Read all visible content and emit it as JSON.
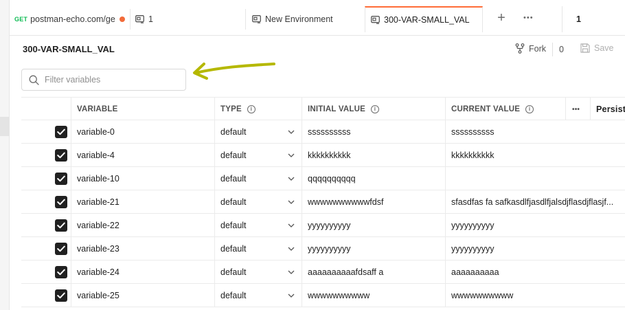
{
  "tabs": [
    {
      "method": "GET",
      "label": "postman-echo.com/ge",
      "unsaved": true
    },
    {
      "label": "1"
    },
    {
      "label": "New Environment"
    },
    {
      "label": "300-VAR-SMALL_VAL",
      "active": true
    }
  ],
  "tabbar": {
    "new_tab": "+",
    "more": "•••",
    "environment_selector": "1"
  },
  "header": {
    "title": "300-VAR-SMALL_VAL",
    "fork_label": "Fork",
    "fork_count": "0",
    "save_label": "Save"
  },
  "filter": {
    "placeholder": "Filter variables",
    "value": ""
  },
  "table": {
    "headers": {
      "variable": "VARIABLE",
      "type": "TYPE",
      "initial": "INITIAL VALUE",
      "current": "CURRENT VALUE",
      "more": "•••",
      "persist": "Persist"
    },
    "rows": [
      {
        "enabled": true,
        "variable": "variable-0",
        "type": "default",
        "initial": "ssssssssss",
        "current": "ssssssssss"
      },
      {
        "enabled": true,
        "variable": "variable-4",
        "type": "default",
        "initial": "kkkkkkkkkk",
        "current": "kkkkkkkkkk"
      },
      {
        "enabled": true,
        "variable": "variable-10",
        "type": "default",
        "initial": "qqqqqqqqqq",
        "current": ""
      },
      {
        "enabled": true,
        "variable": "variable-21",
        "type": "default",
        "initial": "wwwwwwwwwwfdsf",
        "current": "sfasdfas fa safkasdlfjasdlfjalsdjflasdjflasjf..."
      },
      {
        "enabled": true,
        "variable": "variable-22",
        "type": "default",
        "initial": "yyyyyyyyyy",
        "current": "yyyyyyyyyy"
      },
      {
        "enabled": true,
        "variable": "variable-23",
        "type": "default",
        "initial": "yyyyyyyyyy",
        "current": "yyyyyyyyyy"
      },
      {
        "enabled": true,
        "variable": "variable-24",
        "type": "default",
        "initial": "aaaaaaaaaafdsaff a",
        "current": "aaaaaaaaaa"
      },
      {
        "enabled": true,
        "variable": "variable-25",
        "type": "default",
        "initial": "wwwwwwwwww",
        "current": "wwwwwwwwww"
      }
    ]
  },
  "colors": {
    "accent": "#ff6c37",
    "get_method": "#0cbb52",
    "unsaved_dot": "#f26b3a",
    "annotation_arrow": "#b5b800"
  }
}
